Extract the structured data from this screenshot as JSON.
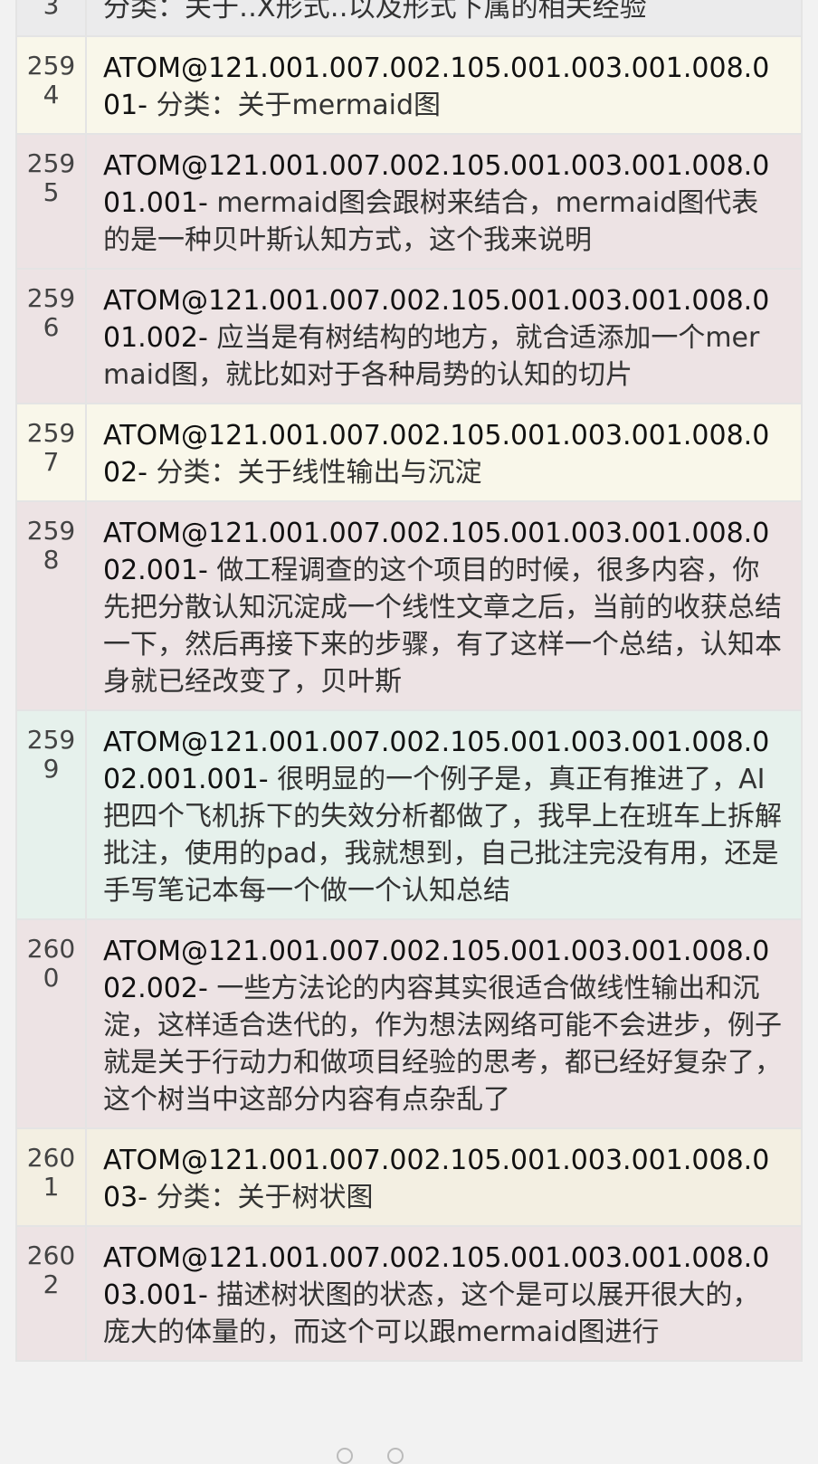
{
  "rows": [
    {
      "num": "3",
      "id": "",
      "text": "分类：关于‥X形式‥以及形式下属的相关经验",
      "color": "gray"
    },
    {
      "num": "2594",
      "id": "ATOM@121.001.007.002.105.001.003.001.008.001-",
      "text": " 分类：关于mermaid图",
      "color": "yellow"
    },
    {
      "num": "2595",
      "id": "ATOM@121.001.007.002.105.001.003.001.008.001.001-",
      "text": " mermaid图会跟树来结合，mermaid图代表的是一种贝叶斯认知方式，这个我来说明",
      "color": "pink"
    },
    {
      "num": "2596",
      "id": "ATOM@121.001.007.002.105.001.003.001.008.001.002-",
      "text": " 应当是有树结构的地方，就合适添加一个mermaid图，就比如对于各种局势的认知的切片",
      "color": "pink"
    },
    {
      "num": "2597",
      "id": "ATOM@121.001.007.002.105.001.003.001.008.002-",
      "text": " 分类：关于线性输出与沉淀",
      "color": "yellow"
    },
    {
      "num": "2598",
      "id": "ATOM@121.001.007.002.105.001.003.001.008.002.001-",
      "text": " 做工程调查的这个项目的时候，很多内容，你先把分散认知沉淀成一个线性文章之后，当前的收获总结一下，然后再接下来的步骤，有了这样一个总结，认知本身就已经改变了，贝叶斯",
      "color": "pink"
    },
    {
      "num": "2599",
      "id": "ATOM@121.001.007.002.105.001.003.001.008.002.001.001-",
      "text": " 很明显的一个例子是，真正有推进了，AI把四个飞机拆下的失效分析都做了，我早上在班车上拆解批注，使用的pad，我就想到，自己批注完没有用，还是手写笔记本每一个做一个认知总结",
      "color": "green"
    },
    {
      "num": "2600",
      "id": "ATOM@121.001.007.002.105.001.003.001.008.002.002-",
      "text": " 一些方法论的内容其实很适合做线性输出和沉淀，这样适合迭代的，作为想法网络可能不会进步，例子就是关于行动力和做项目经验的思考，都已经好复杂了，这个树当中这部分内容有点杂乱了",
      "color": "pink"
    },
    {
      "num": "2601",
      "id": "ATOM@121.001.007.002.105.001.003.001.008.003-",
      "text": " 分类：关于树状图",
      "color": "beige"
    },
    {
      "num": "2602",
      "id": "ATOM@121.001.007.002.105.001.003.001.008.003.001-",
      "text": " 描述树状图的状态，这个是可以展开很大的，庞大的体量的，而这个可以跟mermaid图进行",
      "color": "pink"
    }
  ]
}
